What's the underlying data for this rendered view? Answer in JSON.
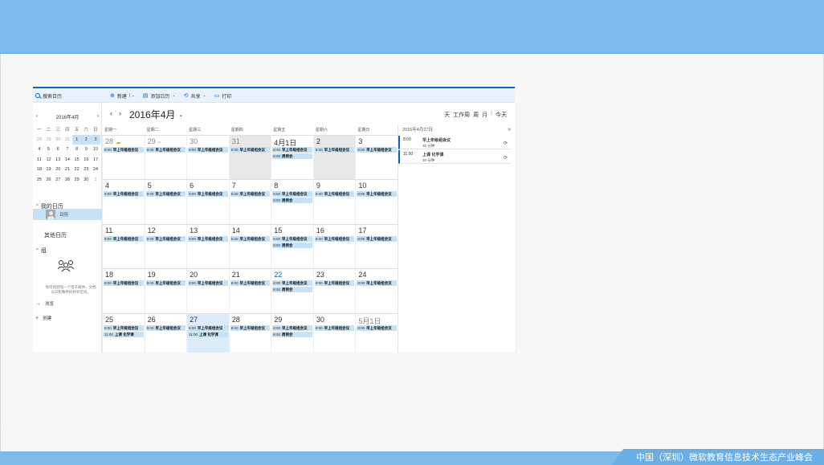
{
  "footer": {
    "text": "中国（深圳）微软教育信息技术生态产业峰会"
  },
  "toolbar": {
    "search_placeholder": "搜索日历",
    "new_label": "新建",
    "add_calendar_label": "添加日历",
    "share_label": "共享",
    "print_label": "打印"
  },
  "mini_cal": {
    "title": "2016年4月",
    "prev": "‹",
    "next": "›",
    "weekdays": [
      "一",
      "二",
      "三",
      "四",
      "五",
      "六",
      "日"
    ],
    "weeks": [
      [
        "28",
        "29",
        "30",
        "31",
        "1",
        "2",
        "3"
      ],
      [
        "4",
        "5",
        "6",
        "7",
        "8",
        "9",
        "10"
      ],
      [
        "11",
        "12",
        "13",
        "14",
        "15",
        "16",
        "17"
      ],
      [
        "18",
        "19",
        "20",
        "21",
        "22",
        "23",
        "24"
      ],
      [
        "25",
        "26",
        "27",
        "28",
        "29",
        "30",
        "1"
      ]
    ]
  },
  "sidebar": {
    "my_calendars": "我的日历",
    "calendar_item": "日历",
    "other_calendars": "其他日历",
    "groups": "组",
    "group_desc": "你可找到现一个电子邮件、文档以日和事件的共享空间。",
    "browse": "浏览",
    "create": "创建"
  },
  "header": {
    "title": "2016年4月",
    "views": [
      "天",
      "工作周",
      "周",
      "月"
    ],
    "active_view": "月",
    "today": "今天"
  },
  "weekdays": [
    "星期一",
    "星期二",
    "星期三",
    "星期四",
    "星期五",
    "星期六",
    "星期日"
  ],
  "days": [
    [
      "28",
      "29",
      "30",
      "31",
      "4月1日",
      "2",
      "3"
    ],
    [
      "4",
      "5",
      "6",
      "7",
      "8",
      "9",
      "10"
    ],
    [
      "11",
      "12",
      "13",
      "14",
      "15",
      "16",
      "17"
    ],
    [
      "18",
      "19",
      "20",
      "21",
      "22",
      "23",
      "24"
    ],
    [
      "25",
      "26",
      "27",
      "28",
      "29",
      "30",
      "5月1日"
    ]
  ],
  "event": {
    "time": "8:00",
    "name": "早上年级组会议",
    "meeting_name": "周例会",
    "class_time": "11:00",
    "class_name": "上课 化学课"
  },
  "agenda": {
    "date": "2016年4月27日",
    "chevron": "»",
    "items": [
      {
        "time": "8:00",
        "name": "早上年级组会议",
        "duration": "30 分钟",
        "icon": "⟳"
      },
      {
        "time": "11:00",
        "name": "上课 化学课",
        "duration": "30 分钟",
        "icon": "⟳"
      }
    ]
  }
}
